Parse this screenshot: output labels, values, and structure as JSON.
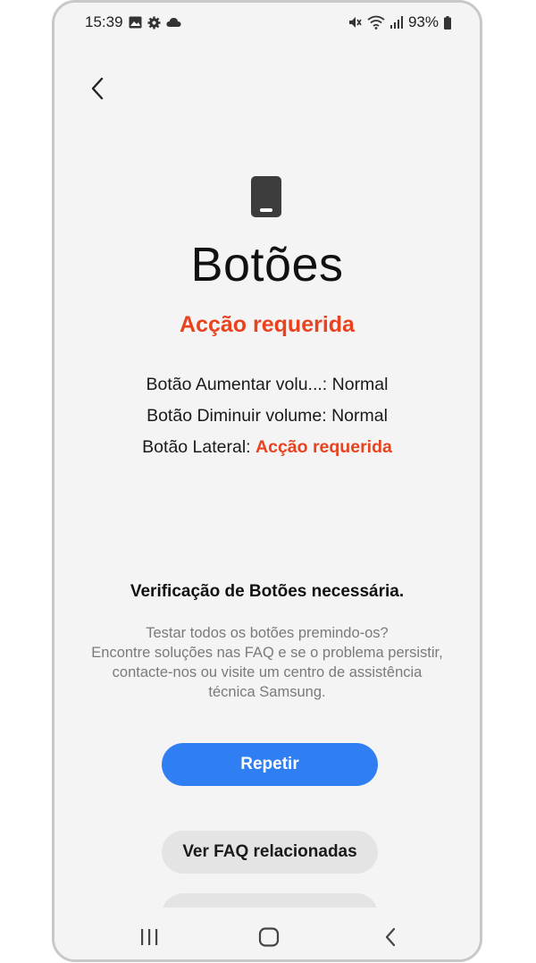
{
  "status_bar": {
    "time": "15:39",
    "left_icons": [
      "gallery-icon",
      "gear-icon",
      "cloud-icon"
    ],
    "right_icons": [
      "mute-icon",
      "wifi-icon",
      "signal-icon"
    ],
    "battery": "93%"
  },
  "page": {
    "title": "Botões",
    "status": "Acção requerida"
  },
  "results": [
    {
      "label": "Botão Aumentar volu...: ",
      "value": "Normal",
      "state": "ok"
    },
    {
      "label": "Botão Diminuir volume: ",
      "value": "Normal",
      "state": "ok"
    },
    {
      "label": "Botão Lateral: ",
      "value": "Acção requerida",
      "state": "action"
    }
  ],
  "verification": {
    "title": "Verificação de Botões necessária.",
    "description_lines": [
      "Testar todos os botões premindo-os?",
      "Encontre soluções nas FAQ e se o problema persistir,",
      "contacte-nos ou visite um centro de assistência",
      "técnica Samsung."
    ]
  },
  "actions": {
    "retry_label": "Repetir",
    "faq_label": "Ver FAQ relacionadas"
  },
  "colors": {
    "accent_blue": "#2f7ff3",
    "warning_red": "#e8421f",
    "background": "#f4f4f4"
  }
}
